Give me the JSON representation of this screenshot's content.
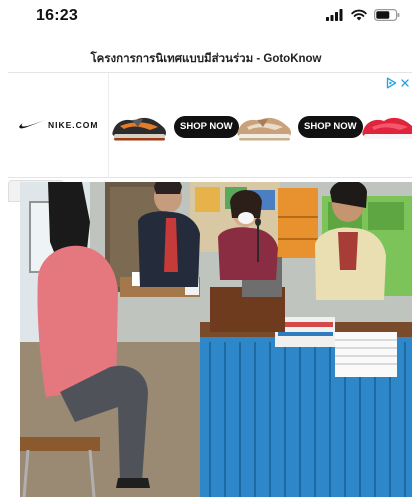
{
  "status_bar": {
    "time": "16:23"
  },
  "page": {
    "title": "โครงการการนิเทศแบบมีส่วนร่วม - GotoKnow"
  },
  "ad": {
    "brand": "NIKE.COM",
    "shop_buttons": [
      "SHOP NOW",
      "SHOP NOW"
    ],
    "colors": {
      "button_bg": "#111111",
      "adchoices": "#27a3e3"
    },
    "icons": [
      "nike-swoosh",
      "adchoices-triangle",
      "close-x"
    ]
  },
  "photo": {
    "icons": [
      "chevron-up"
    ]
  }
}
